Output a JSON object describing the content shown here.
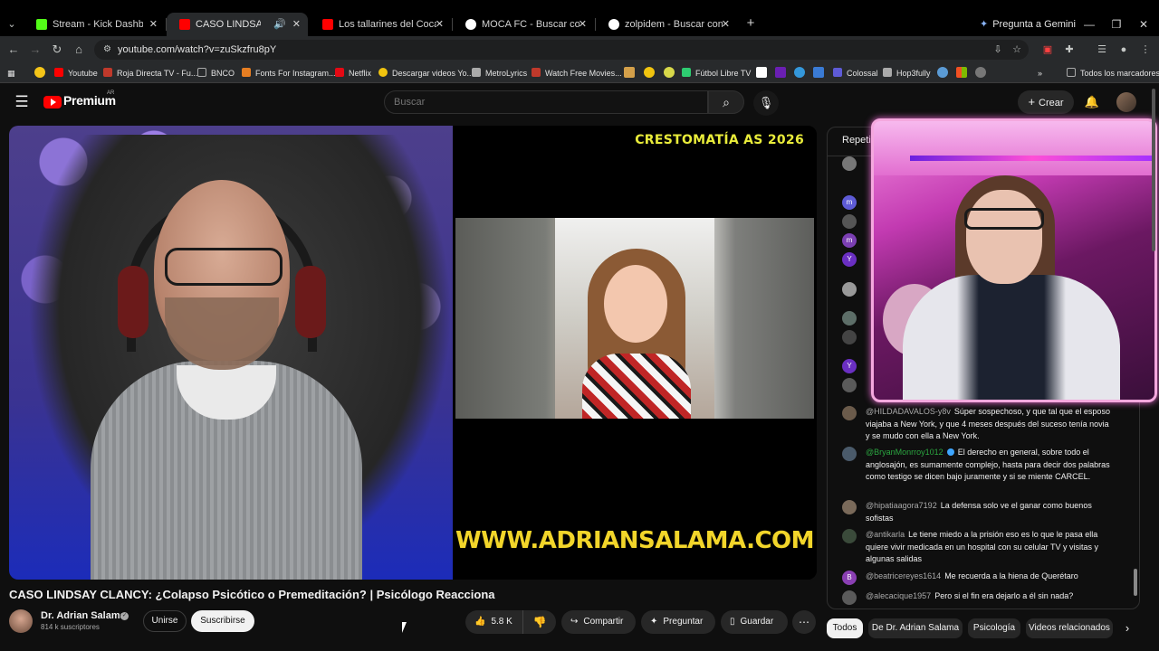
{
  "browser": {
    "tabs": [
      {
        "title": "Stream - Kick Dashboard",
        "favicon_color": "#53fc18",
        "active": false
      },
      {
        "title": "CASO LINDSAY CLANCY: ¿C",
        "favicon_color": "#ff0000",
        "active": true
      },
      {
        "title": "Los tallarines del Coca Mendoza",
        "favicon_color": "#ff0000",
        "active": false
      },
      {
        "title": "MOCA FC - Buscar con Google",
        "favicon_color": "#ffffff",
        "active": false
      },
      {
        "title": "zolpidem - Buscar con Google",
        "favicon_color": "#ffffff",
        "active": false
      }
    ],
    "gemini_label": "Pregunta a Gemini",
    "url": "youtube.com/watch?v=zuSkzfru8pY",
    "bookmarks": [
      {
        "label": "Youtube",
        "color": "#ff0000"
      },
      {
        "label": "Roja Directa TV - Fu...",
        "color": "#c0392b"
      },
      {
        "label": "BNCO",
        "color": "#888888"
      },
      {
        "label": "Fonts For Instagram...",
        "color": "#e67e22"
      },
      {
        "label": "Netflix",
        "color": "#e50914"
      },
      {
        "label": "Descargar videos Yo...",
        "color": "#f1c40f"
      },
      {
        "label": "MetroLyrics",
        "color": "#aaaaaa"
      },
      {
        "label": "Watch Free Movies...",
        "color": "#c0392b"
      },
      {
        "label": "Fútbol Libre TV",
        "color": "#2ecc71"
      },
      {
        "label": "Colossal",
        "color": "#aaaaaa"
      },
      {
        "label": "Hop3fully",
        "color": "#aaaaaa"
      }
    ],
    "all_bookmarks_label": "Todos los marcadores"
  },
  "youtube": {
    "logo_text": "Premium",
    "logo_country": "AR",
    "search_placeholder": "Buscar",
    "create_label": "Crear"
  },
  "video": {
    "overlay_top": "CRESTOMATÍA AS 2026",
    "overlay_bottom": "WWW.ADRIANSALAMA.COM",
    "title": "CASO LINDSAY CLANCY: ¿Colapso Psicótico o Premeditación? | Psicólogo Reacciona",
    "channel_name": "Dr. Adrian Salama",
    "subscribers": "814 k suscriptores",
    "join_label": "Unirse",
    "subscribe_label": "Suscribirse",
    "likes": "5.8 K",
    "share_label": "Compartir",
    "ask_label": "Preguntar",
    "save_label": "Guardar"
  },
  "chat": {
    "title": "Repeti",
    "side_avatars": [
      {
        "letter": "",
        "color": "#777777"
      },
      {
        "letter": "m",
        "color": "#5e5bd6"
      },
      {
        "letter": "",
        "color": "#555555"
      },
      {
        "letter": "m",
        "color": "#7b3fb3"
      },
      {
        "letter": "Y",
        "color": "#6a2fc2"
      },
      {
        "letter": "",
        "color": "#999999"
      },
      {
        "letter": "",
        "color": "#5d6e68"
      },
      {
        "letter": "",
        "color": "#444444"
      },
      {
        "letter": "Y",
        "color": "#6a2fc2"
      },
      {
        "letter": "",
        "color": "#5a5a5a"
      }
    ],
    "messages": [
      {
        "author": "@HILDADAVALOS-y8v",
        "text": "Súper sospechoso, y que tal que el esposo viajaba a New York, y que 4 meses después del suceso tenía novia y se mudo con ella a New York.",
        "avatar_color": "#6b5b4b",
        "avatar_letter": "",
        "member": false
      },
      {
        "author": "@BryanMonrroy1012",
        "text": "El derecho en general, sobre todo el anglosajón, es sumamente complejo, hasta para decir dos palabras como testigo se dicen bajo juramente y si se miente CARCEL.",
        "avatar_color": "#4a5a6a",
        "avatar_letter": "",
        "member": true
      },
      {
        "author": "@hipatiaagora7192",
        "text": "La defensa solo ve el ganar como buenos sofistas",
        "avatar_color": "#7a6a5a",
        "avatar_letter": "",
        "member": false
      },
      {
        "author": "@antikarla",
        "text": "Le tiene miedo a la prisión eso es lo que le pasa ella quiere vivir medicada en un hospital con su celular TV y visitas y algunas salidas",
        "avatar_color": "#3a4a3a",
        "avatar_letter": "",
        "member": false
      },
      {
        "author": "@beatricereyes1614",
        "text": "Me recuerda a la hiena de Querétaro",
        "avatar_color": "#8a3fb3",
        "avatar_letter": "B",
        "member": false
      },
      {
        "author": "@alecacique1957",
        "text": "Pero si el fin era dejarlo a él sin nada?",
        "avatar_color": "#5a5a5a",
        "avatar_letter": "",
        "member": false
      }
    ]
  },
  "filters": [
    "Todos",
    "De Dr. Adrian Salama",
    "Psicología",
    "Videos relacionados"
  ]
}
